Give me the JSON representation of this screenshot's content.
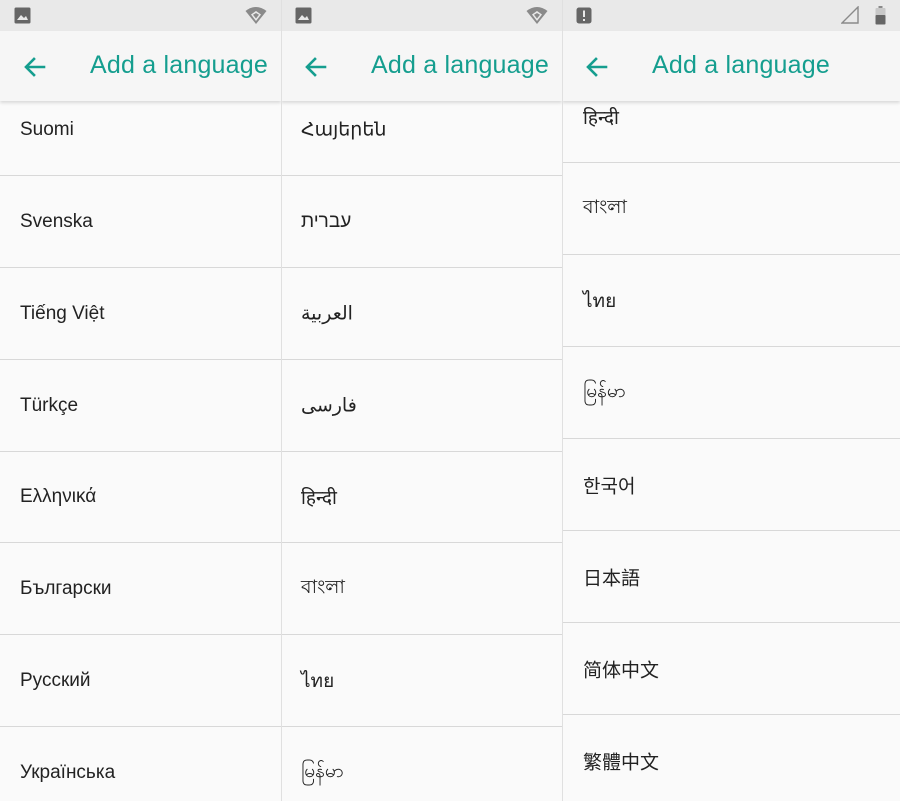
{
  "colors": {
    "accent": "#159e8f",
    "statusbar": "#e9e9e9"
  },
  "panels": [
    {
      "status_icons": [
        "image-icon",
        "wifi-icon"
      ],
      "title": "Add a language",
      "items": [
        "Suomi",
        "Svenska",
        "Tiếng Việt",
        "Türkçe",
        "Ελληνικά",
        "Български",
        "Русский",
        "Українська"
      ]
    },
    {
      "status_icons": [
        "image-icon",
        "wifi-icon"
      ],
      "title": "Add a language",
      "items": [
        "Հայերեն",
        "עברית",
        "العربية",
        "فارسی",
        "हिन्दी",
        "বাংলা",
        "ไทย",
        "မြန်မာ"
      ]
    },
    {
      "status_icons": [
        "alert-icon",
        "cell-signal-icon",
        "battery-icon"
      ],
      "title": "Add a language",
      "items": [
        "हिन्दी",
        "বাংলা",
        "ไทย",
        "မြန်မာ",
        "한국어",
        "日本語",
        "简体中文",
        "繁體中文"
      ]
    }
  ]
}
